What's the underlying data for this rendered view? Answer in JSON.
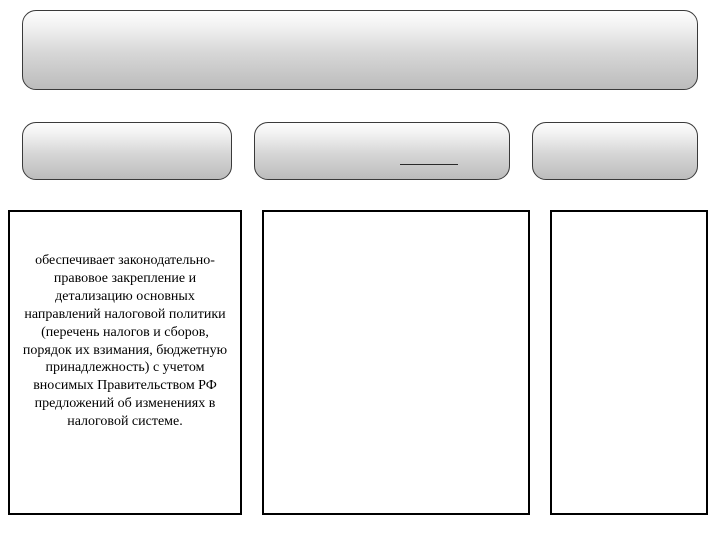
{
  "top": {
    "label": ""
  },
  "middle": {
    "boxes": [
      {
        "label": ""
      },
      {
        "label": ""
      },
      {
        "label": ""
      }
    ]
  },
  "panels": [
    {
      "text": "обеспечивает законодательно-правовое закрепление и детализацию основных направлений налоговой политики (перечень налогов и сборов, порядок их взимания, бюджетную принадлежность) с учетом вносимых Правительством РФ предложений об изменениях в налоговой системе."
    },
    {
      "text": ""
    },
    {
      "text": ""
    }
  ]
}
